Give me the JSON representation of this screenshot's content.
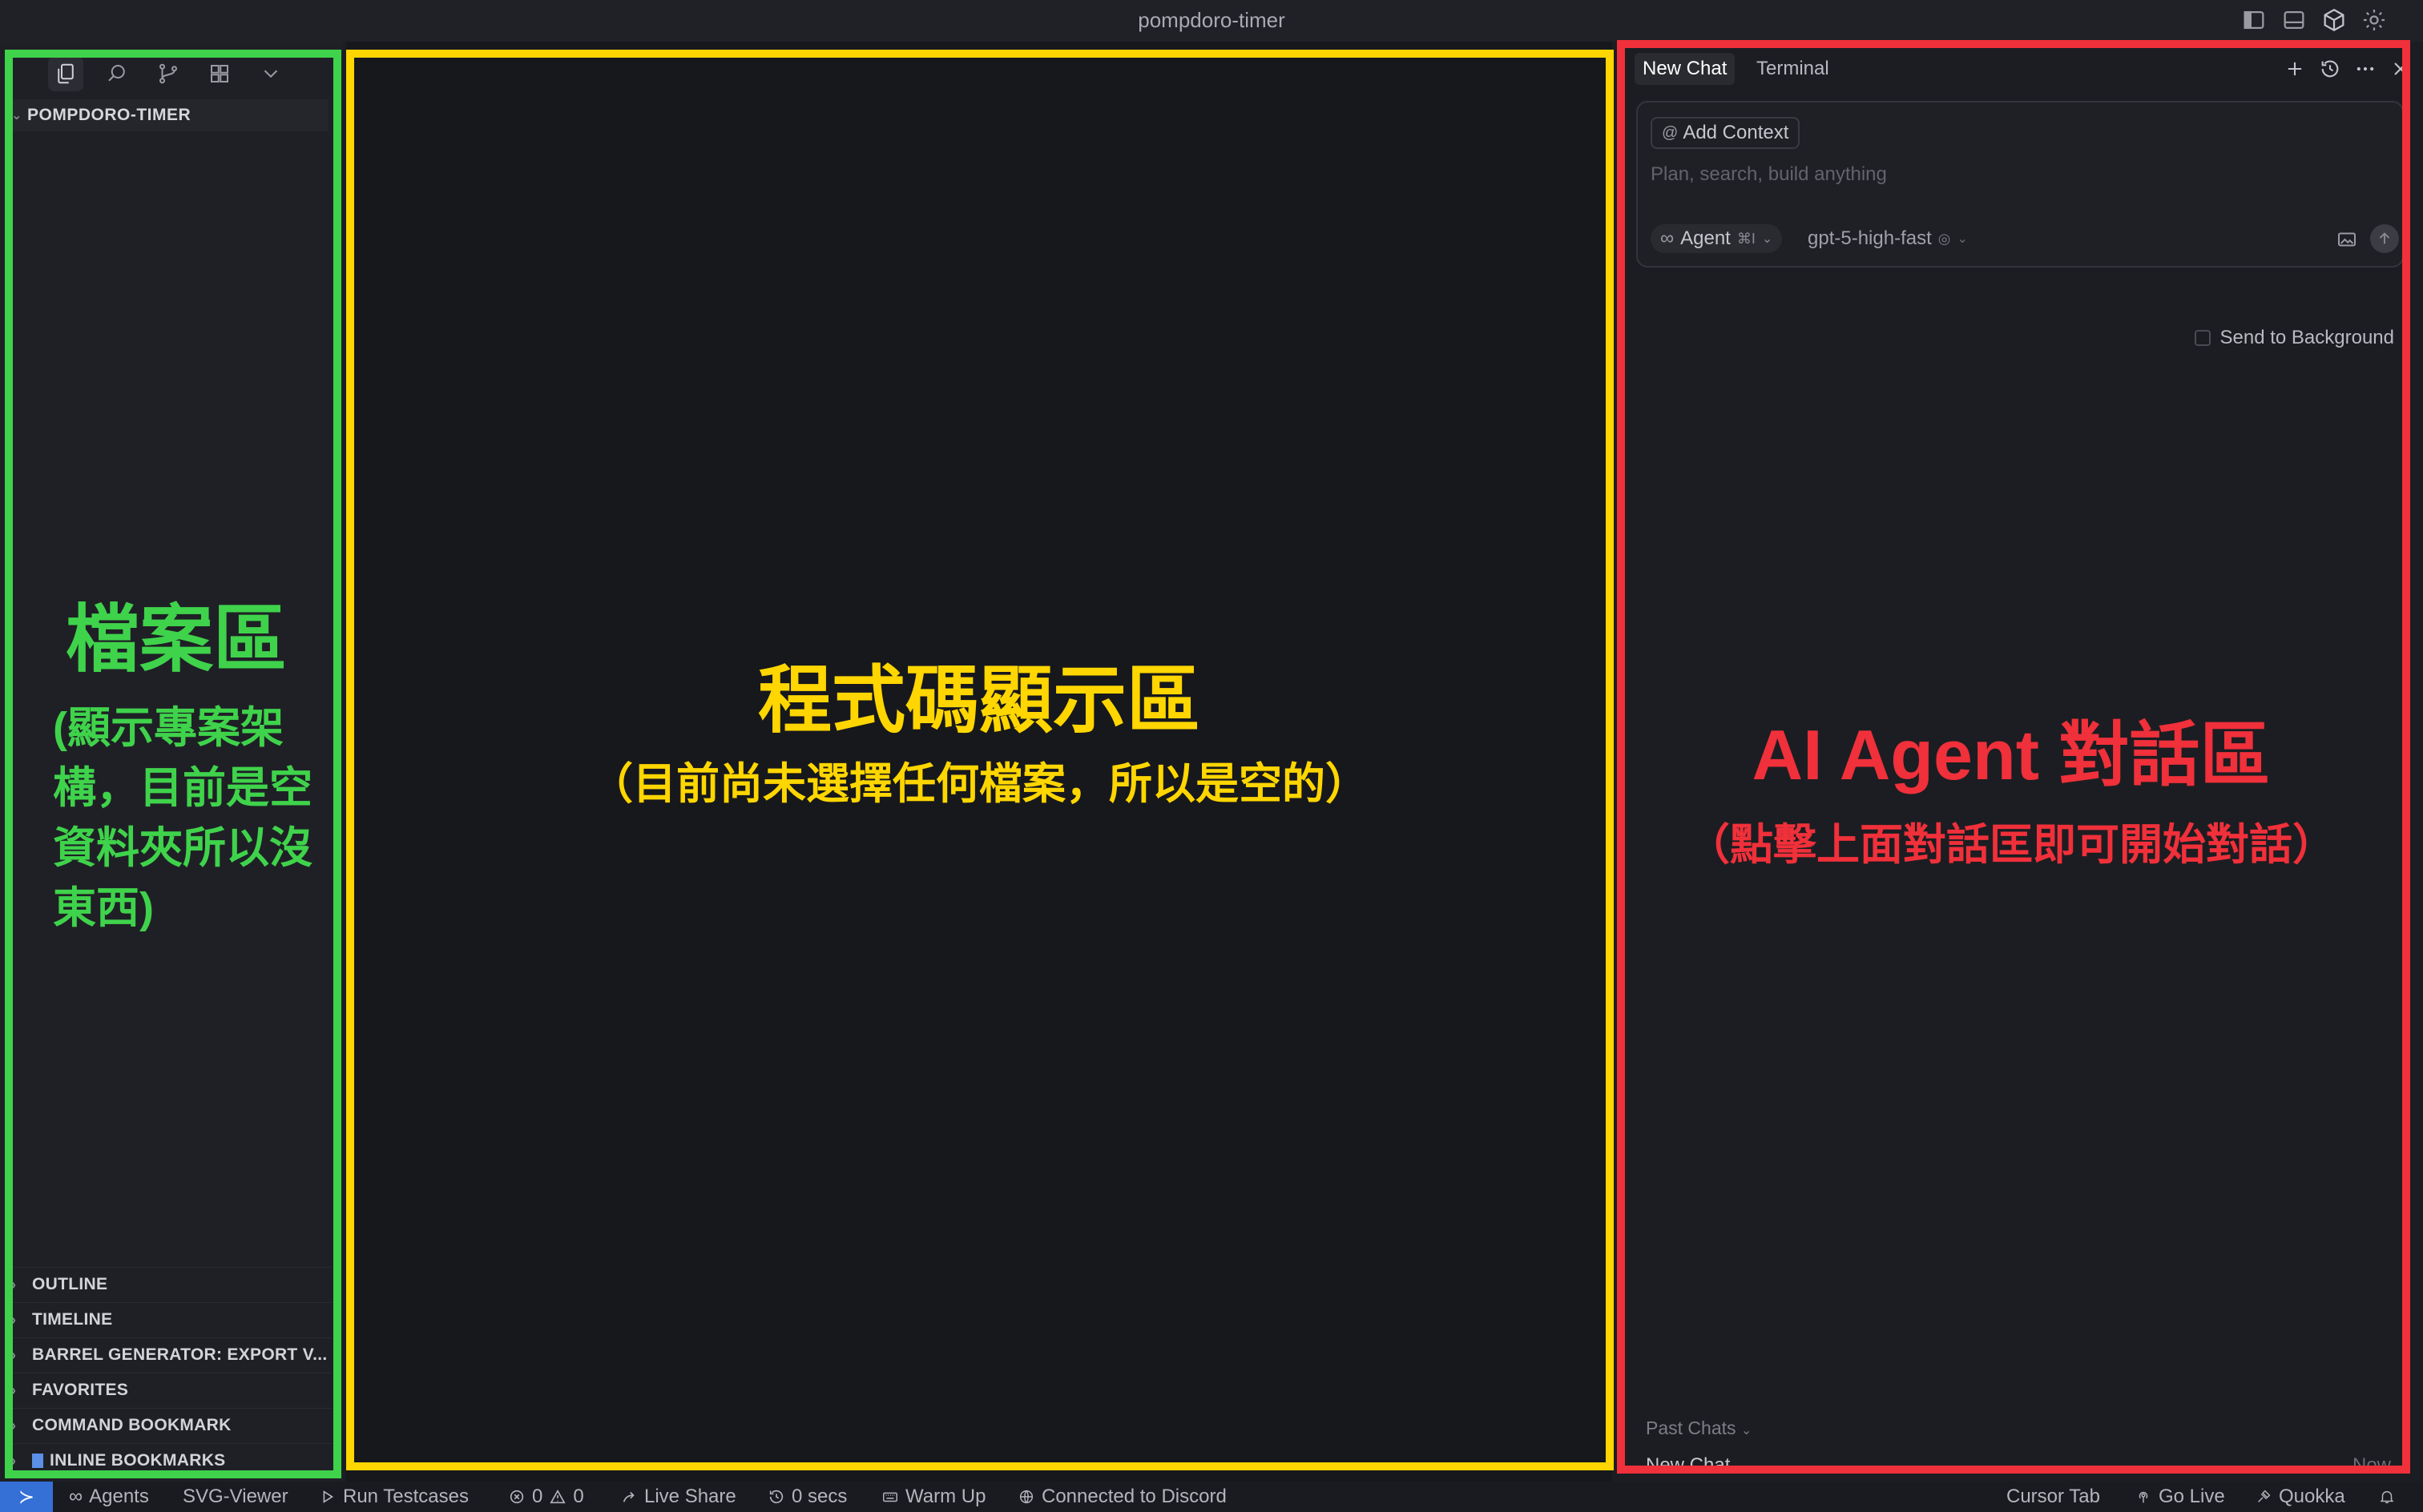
{
  "window": {
    "title": "pompdoro-timer"
  },
  "explorer": {
    "project": "POMPDORO-TIMER",
    "sections": [
      "OUTLINE",
      "TIMELINE",
      "BARREL GENERATOR: EXPORT V...",
      "FAVORITES",
      "COMMAND BOOKMARK",
      "INLINE BOOKMARKS"
    ]
  },
  "chat": {
    "tabs": [
      "New Chat",
      "Terminal"
    ],
    "add_context": "Add Context",
    "placeholder": "Plan, search, build anything",
    "agent_label": "Agent",
    "agent_shortcut": "⌘I",
    "model": "gpt-5-high-fast",
    "send_to_background": "Send to Background",
    "past_chats_label": "Past Chats",
    "past_item": "New Chat",
    "past_item_time": "Now"
  },
  "statusbar": {
    "agents": "Agents",
    "svg_viewer": "SVG-Viewer",
    "run_testcases": "Run Testcases",
    "errors": "0",
    "warnings": "0",
    "live_share": "Live Share",
    "timer": "0 secs",
    "warm_up": "Warm Up",
    "discord": "Connected to Discord",
    "cursor_tab": "Cursor Tab",
    "go_live": "Go Live",
    "quokka": "Quokka"
  },
  "annotations": {
    "files_title": "檔案區",
    "files_desc": "(顯示專案架構，目前是空資料夾所以沒東西)",
    "code_title": "程式碼顯示區",
    "code_desc": "（目前尚未選擇任何檔案，所以是空的）",
    "chat_title": "AI Agent 對話區",
    "chat_desc": "（點擊上面對話匡即可開始對話）"
  },
  "colors": {
    "files_frame": "#3fd34b",
    "code_frame": "#ffd600",
    "chat_frame": "#f0303a",
    "remote_badge": "#3470d6"
  }
}
